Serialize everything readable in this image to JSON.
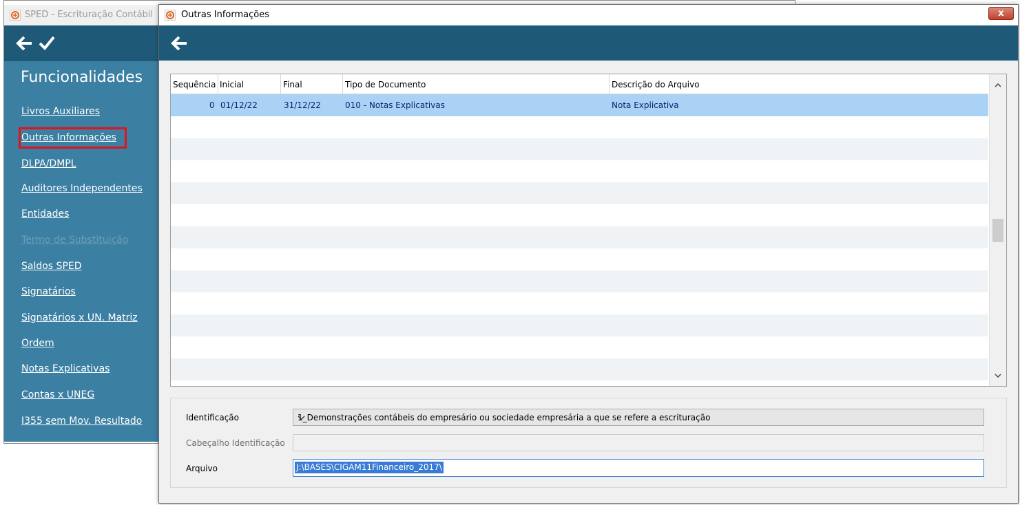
{
  "back_window": {
    "title": "SPED - Escrituração Contábil",
    "top_strip_text": "...",
    "sidebar": {
      "title": "Funcionalidades",
      "items": [
        {
          "label": "Livros Auxiliares"
        },
        {
          "label": "Outras Informações"
        },
        {
          "label": "DLPA/DMPL"
        },
        {
          "label": "Auditores Independentes"
        },
        {
          "label": "Entidades"
        },
        {
          "label": "Termo de Substituição"
        },
        {
          "label": "Saldos SPED"
        },
        {
          "label": "Signatários"
        },
        {
          "label": "Signatários x UN. Matriz"
        },
        {
          "label": "Ordem"
        },
        {
          "label": "Notas Explicativas"
        },
        {
          "label": "Contas x UNEG"
        },
        {
          "label": "I355 sem Mov. Resultado"
        }
      ]
    }
  },
  "dialog": {
    "title": "Outras Informações",
    "close_label": "x",
    "grid": {
      "columns": [
        "Sequência",
        "Inicial",
        "Final",
        "Tipo de Documento",
        "Descrição do Arquivo"
      ],
      "rows": [
        {
          "sequencia": "0",
          "inicial": "01/12/22",
          "final": "31/12/22",
          "tipo": "010 - Notas Explicativas",
          "descricao": "Nota Explicativa"
        }
      ]
    },
    "form": {
      "identificacao_label": "Identificação",
      "identificacao_value": "1_Demonstrações contábeis do empresário ou sociedade empresária a que se refere a escrituração",
      "cabecalho_label": "Cabeçalho Identificação",
      "cabecalho_value": "",
      "arquivo_label": "Arquivo",
      "arquivo_value": "J:\\BASES\\CIGAM11Financeiro_2017\\"
    }
  },
  "icons": {
    "app": "sped-app-icon",
    "back": "arrow-left-icon",
    "confirm": "check-icon",
    "close": "close-icon",
    "dropdown": "chevron-down-icon"
  },
  "colors": {
    "toolbar": "#1e5a77",
    "sidebar": "#3b7fa2",
    "selected_row": "#a9d2f5",
    "highlight": "#e3121b",
    "close_button": "#c1402a"
  }
}
